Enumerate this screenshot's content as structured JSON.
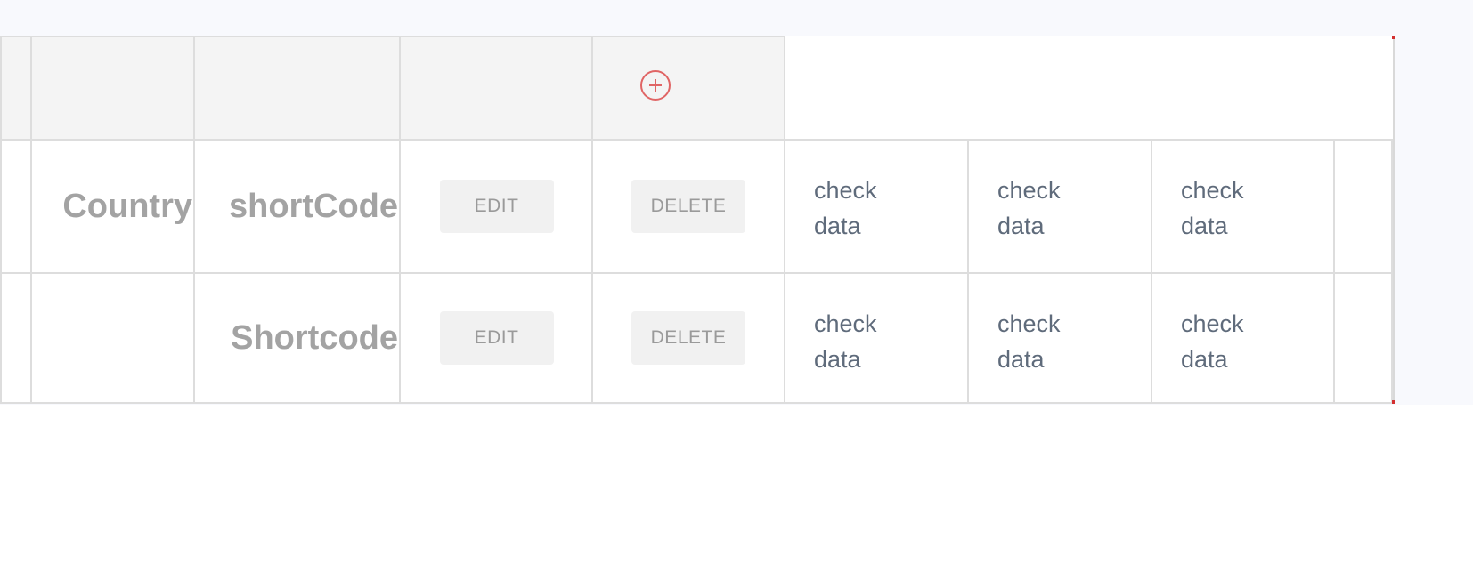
{
  "table": {
    "header": {
      "add_icon": "plus-circle-icon",
      "accent_color": "#e06565"
    },
    "rows": [
      {
        "country": "Country",
        "shortcode": "shortCode",
        "edit_label": "EDIT",
        "delete_label": "DELETE",
        "checks": [
          "check",
          "data",
          "check",
          "data",
          "check",
          "data"
        ]
      },
      {
        "country": "",
        "shortcode": "Shortcode",
        "edit_label": "EDIT",
        "delete_label": "DELETE",
        "checks": [
          "check",
          "data",
          "check",
          "data",
          "check",
          "data"
        ]
      }
    ]
  }
}
